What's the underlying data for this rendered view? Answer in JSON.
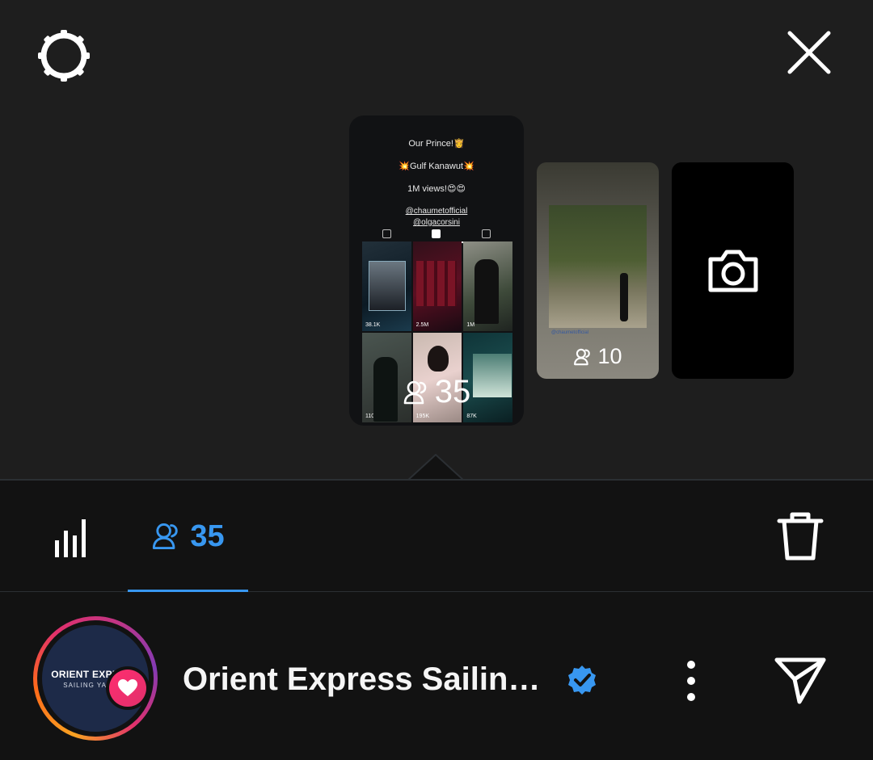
{
  "story_main": {
    "line1": "Our Prince!👸",
    "line2": "💥Gulf Kanawut💥",
    "line3": "1M views!😍😍",
    "handle1": "@chaumetofficial",
    "handle2": "@olgacorsini",
    "views": [
      "38.1K",
      "2.5M",
      "1M",
      "110K",
      "195K",
      "87K"
    ],
    "viewer_count": "35"
  },
  "story_small": {
    "caption": "@chaumetofficial",
    "viewer_count": "10"
  },
  "tabs": {
    "viewers_count": "35"
  },
  "account": {
    "avatar_line1": "ORIENT EXPRESS",
    "avatar_line2": "SAILING YACHTS",
    "name": "Orient Express Sailin…"
  },
  "colors": {
    "accent": "#3897f0",
    "verified": "#3897f0",
    "heart_badge": "#ff2d6f"
  },
  "icons": [
    "gear-icon",
    "close-icon",
    "camera-icon",
    "bar-chart-icon",
    "people-icon",
    "trash-icon",
    "heart-icon",
    "verified-icon",
    "more-vertical-icon",
    "send-icon"
  ]
}
